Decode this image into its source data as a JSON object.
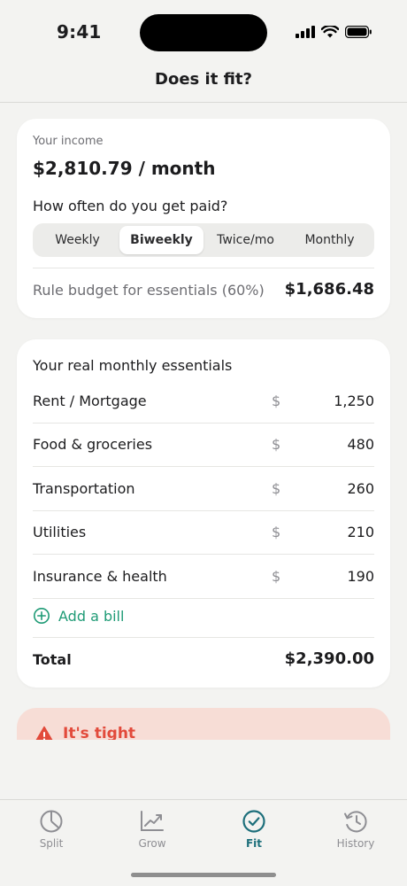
{
  "status": {
    "time": "9:41"
  },
  "header": {
    "title": "Does it fit?"
  },
  "income": {
    "label": "Your income",
    "value": "$2,810.79 / month",
    "frequency_question": "How often do you get paid?",
    "frequency_options": [
      "Weekly",
      "Biweekly",
      "Twice/mo",
      "Monthly"
    ],
    "selected_frequency": "Biweekly",
    "rule_label": "Rule budget for essentials (60%)",
    "rule_value": "$1,686.48"
  },
  "essentials": {
    "title": "Your real monthly essentials",
    "currency_symbol": "$",
    "items": [
      {
        "label": "Rent / Mortgage",
        "value": "1,250"
      },
      {
        "label": "Food & groceries",
        "value": "480"
      },
      {
        "label": "Transportation",
        "value": "260"
      },
      {
        "label": "Utilities",
        "value": "210"
      },
      {
        "label": "Insurance & health",
        "value": "190"
      }
    ],
    "add_label": "Add a bill",
    "total_label": "Total",
    "total_value": "$2,390.00"
  },
  "alert": {
    "text": "It's tight",
    "color": "#e24a3b",
    "background": "#f7ddd6"
  },
  "tabs": [
    {
      "label": "Split",
      "icon": "pie-chart-icon"
    },
    {
      "label": "Grow",
      "icon": "trend-chart-icon"
    },
    {
      "label": "Fit",
      "icon": "check-circle-icon",
      "active": true
    },
    {
      "label": "History",
      "icon": "history-icon"
    }
  ],
  "colors": {
    "accent": "#1d6f7b",
    "add_green": "#1f9b76",
    "background": "#f3f3f1"
  }
}
